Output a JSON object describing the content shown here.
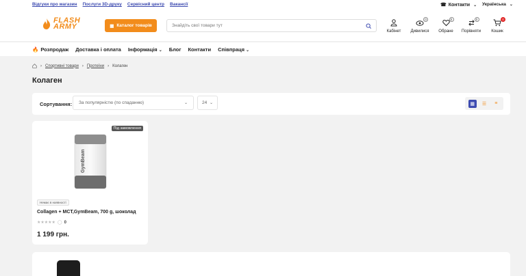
{
  "topbar": {
    "links": [
      "Відгуки про магазин",
      "Послуги 3D-друку",
      "Сервісний центр",
      "Вакансії"
    ],
    "contacts_label": "Контакти",
    "language": "Українська"
  },
  "header": {
    "logo_line1": "FLASH",
    "logo_line2": "ARMY",
    "catalog_button": "Каталог товарів",
    "search_placeholder": "Знайдіть свої товари тут",
    "icons": [
      {
        "label": "Кабінет",
        "icon": "user-icon",
        "badge": ""
      },
      {
        "label": "Дивилися",
        "icon": "eye-icon",
        "badge": "0"
      },
      {
        "label": "Обране",
        "icon": "heart-icon",
        "badge": "0"
      },
      {
        "label": "Порівняти",
        "icon": "compare-icon",
        "badge": "0"
      },
      {
        "label": "Кошик",
        "icon": "cart-icon",
        "badge": "0"
      }
    ]
  },
  "nav": {
    "items": [
      "Розпродаж",
      "Доставка і оплата",
      "Інформація",
      "Блог",
      "Контакти",
      "Співпраця"
    ]
  },
  "breadcrumb": [
    "Спортивні товари",
    "Протеїни",
    "Колаген"
  ],
  "page_title": "Колаген",
  "sort": {
    "label": "Сортування:",
    "selected": "За популярністю (по спаданню)",
    "per_page": "24"
  },
  "products": [
    {
      "badge": "Під замовлення",
      "availability": "Немає в наявності",
      "name": "Collagen + MCT,GymBeam, 700 g, шоколад",
      "pack_brand": "GymBeam",
      "rating_count": "0",
      "price": "1 199 грн."
    }
  ],
  "colors": {
    "accent": "#f28c1b",
    "link": "#3d4bb0",
    "badge_red": "#e02424"
  }
}
